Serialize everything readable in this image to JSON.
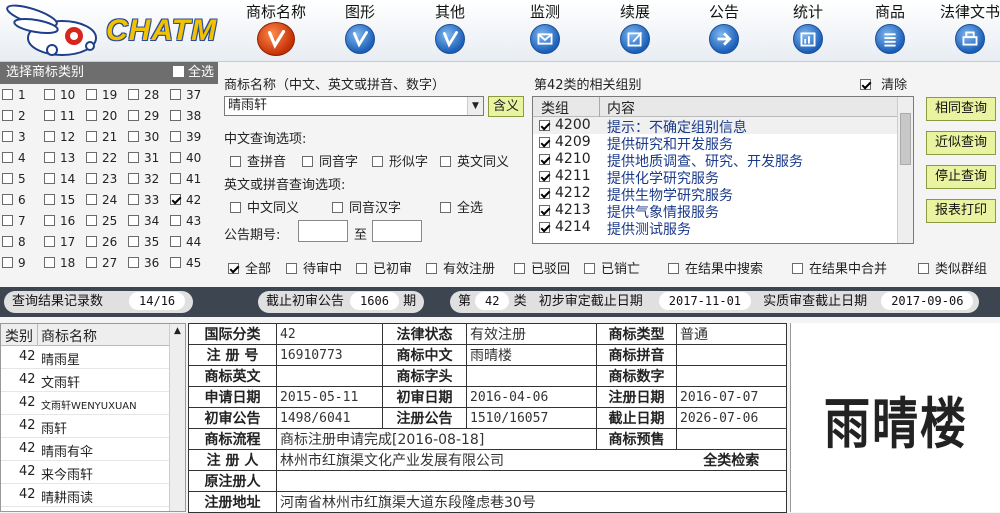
{
  "app": {
    "logo": "CHATM"
  },
  "toolbar": {
    "items": [
      {
        "label": "商标名称",
        "icon": "pen-icon",
        "active": true
      },
      {
        "label": "图形",
        "icon": "pen-icon"
      },
      {
        "label": "其他",
        "icon": "pen-icon"
      },
      {
        "label": "监测",
        "icon": "mail-icon"
      },
      {
        "label": "续展",
        "icon": "edit-icon"
      },
      {
        "label": "公告",
        "icon": "arrow-right-icon"
      },
      {
        "label": "统计",
        "icon": "bar-chart-icon"
      },
      {
        "label": "商品",
        "icon": "list-icon"
      },
      {
        "label": "法律文书",
        "icon": "printer-icon"
      }
    ]
  },
  "category_panel": {
    "title": "选择商标类别",
    "select_all": "全选",
    "checked": [
      "42"
    ],
    "numbers": [
      "1",
      "2",
      "3",
      "4",
      "5",
      "6",
      "7",
      "8",
      "9",
      "10",
      "11",
      "12",
      "13",
      "14",
      "15",
      "16",
      "17",
      "18",
      "19",
      "20",
      "21",
      "22",
      "23",
      "24",
      "25",
      "26",
      "27",
      "28",
      "29",
      "30",
      "31",
      "32",
      "33",
      "34",
      "35",
      "36",
      "37",
      "38",
      "39",
      "40",
      "41",
      "42",
      "43",
      "44",
      "45"
    ]
  },
  "query": {
    "name_label": "商标名称（中文、英文或拼音、数字）",
    "name_value": "晴雨轩",
    "meaning_button": "含义",
    "cn_options_label": "中文查询选项:",
    "cn_options": [
      "查拼音",
      "同音字",
      "形似字",
      "英文同义"
    ],
    "en_options_label": "英文或拼音查询选项:",
    "en_options": [
      "中文同义",
      "同音汉字",
      "全选"
    ],
    "issue_label": "公告期号:",
    "to_label": "至"
  },
  "groups": {
    "title": "第42类的相关组别",
    "clear_label": "清除",
    "col_group": "类组",
    "col_content": "内容",
    "rows": [
      {
        "code": "4200",
        "desc": "提示：不确定组别信息"
      },
      {
        "code": "4209",
        "desc": "提供研究和开发服务"
      },
      {
        "code": "4210",
        "desc": "提供地质调查、研究、开发服务"
      },
      {
        "code": "4211",
        "desc": "提供化学研究服务"
      },
      {
        "code": "4212",
        "desc": "提供生物学研究服务"
      },
      {
        "code": "4213",
        "desc": "提供气象情报服务"
      },
      {
        "code": "4214",
        "desc": "提供测试服务"
      }
    ]
  },
  "actions": {
    "same_query": "相同查询",
    "similar_query": "近似查询",
    "stop_query": "停止查询",
    "print_report": "报表打印"
  },
  "filters": {
    "all": "全部",
    "pending": "待审中",
    "first_review": "已初审",
    "valid": "有效注册",
    "rejected": "已驳回",
    "cancelled": "已销亡",
    "search_in_results": "在结果中搜索",
    "merge_in_results": "在结果中合并",
    "similar_groups": "类似群组"
  },
  "status": {
    "records_label": "查询结果记录数",
    "records_value": "14/16",
    "deadline_label": "截止初审公告",
    "deadline_value": "1606",
    "deadline_unit": "期",
    "class_prefix": "第",
    "class_value": "42",
    "class_suffix": "类",
    "first_review_date_label": "初步审定截止日期",
    "first_review_date": "2017-11-01",
    "substantive_date_label": "实质审查截止日期",
    "substantive_date": "2017-09-06"
  },
  "results": {
    "col_class": "类别",
    "col_name": "商标名称",
    "rows": [
      {
        "cls": "42",
        "name": "晴雨星"
      },
      {
        "cls": "42",
        "name": "文雨轩"
      },
      {
        "cls": "42",
        "name": "文雨轩WENYUXUAN"
      },
      {
        "cls": "42",
        "name": "雨轩"
      },
      {
        "cls": "42",
        "name": "晴雨有伞"
      },
      {
        "cls": "42",
        "name": "来今雨轩"
      },
      {
        "cls": "42",
        "name": "晴耕雨读"
      }
    ]
  },
  "detail": {
    "intl_class_label": "国际分类",
    "intl_class": "42",
    "legal_status_label": "法律状态",
    "legal_status": "有效注册",
    "mark_type_label": "商标类型",
    "mark_type": "普通",
    "reg_no_label": "注 册 号",
    "reg_no": "16910773",
    "mark_cn_label": "商标中文",
    "mark_cn": "雨晴楼",
    "mark_pinyin_label": "商标拼音",
    "mark_pinyin": "",
    "mark_en_label": "商标英文",
    "mark_en": "",
    "mark_initial_label": "商标字头",
    "mark_initial": "",
    "mark_digit_label": "商标数字",
    "mark_digit": "",
    "apply_date_label": "申请日期",
    "apply_date": "2015-05-11",
    "first_review_date_label": "初审日期",
    "first_review_date": "2016-04-06",
    "reg_date_label": "注册日期",
    "reg_date": "2016-07-07",
    "first_notice_label": "初审公告",
    "first_notice": "1498/6041",
    "reg_notice_label": "注册公告",
    "reg_notice": "1510/16057",
    "expiry_label": "截止日期",
    "expiry": "2026-07-06",
    "flow_label": "商标流程",
    "flow": "商标注册申请完成[2016-08-18]",
    "warning_label": "商标预售",
    "warning": "",
    "registrant_label": "注 册 人",
    "registrant": "林州市红旗渠文化产业发展有限公司",
    "full_search": "全类检索",
    "orig_registrant_label": "原注册人",
    "orig_registrant": "",
    "address_label": "注册地址",
    "address": "河南省林州市红旗渠大道东段隆虑巷30号"
  },
  "preview": {
    "mark_text": "雨晴楼"
  }
}
